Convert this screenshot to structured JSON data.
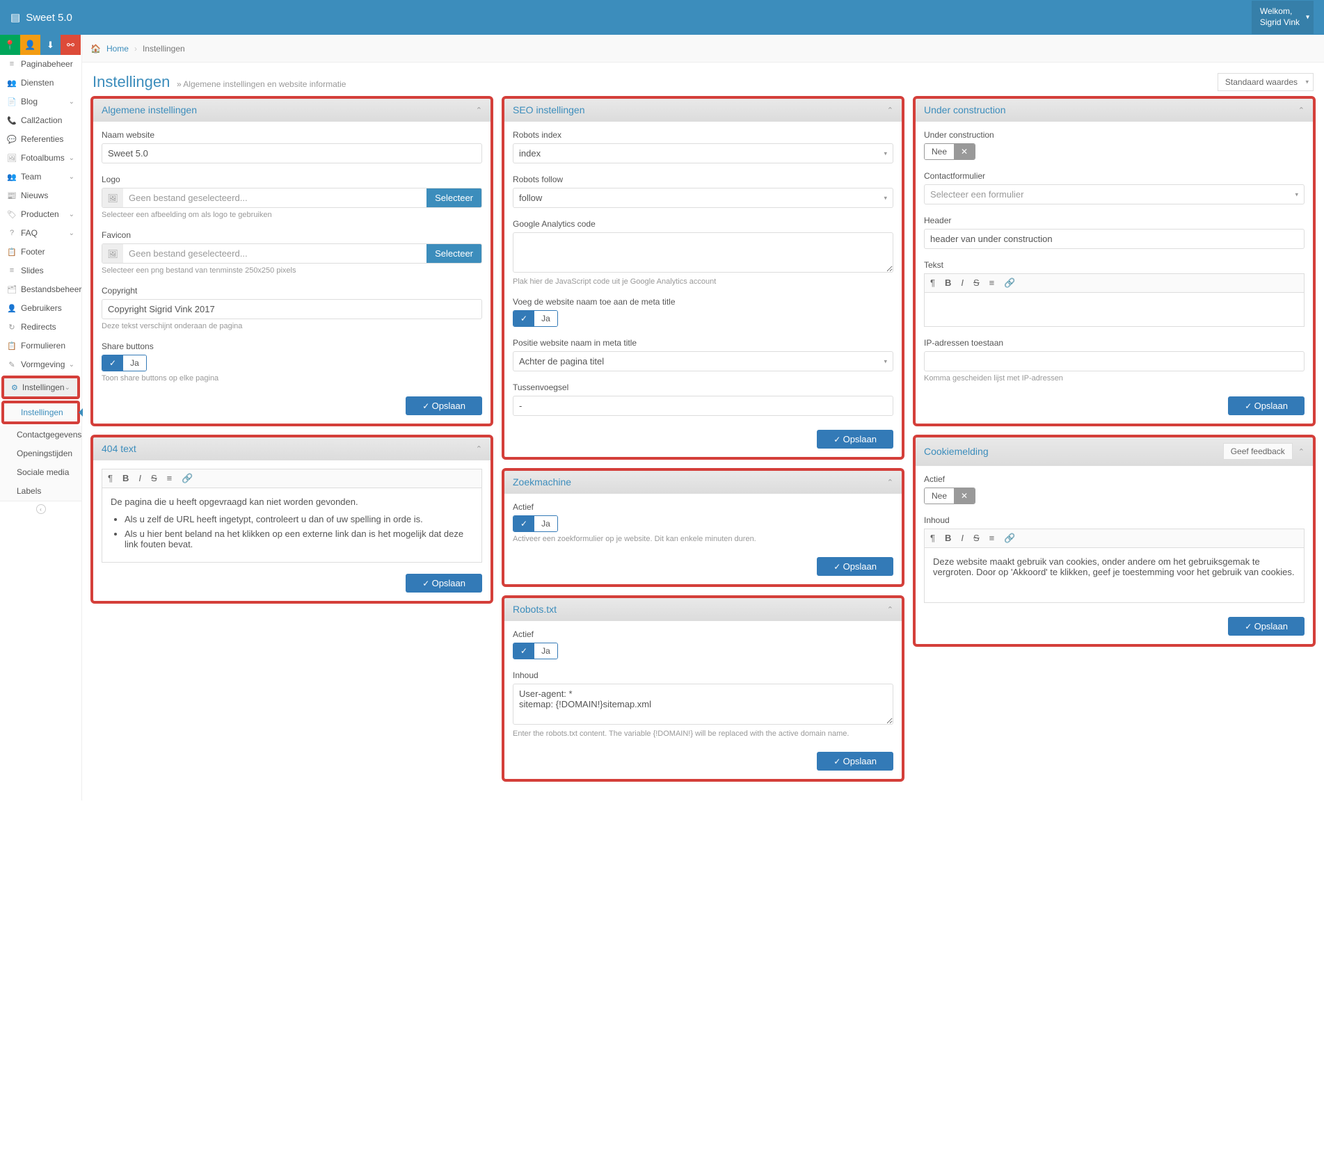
{
  "app": {
    "name": "Sweet 5.0",
    "welcome": "Welkom,",
    "user": "Sigrid Vink"
  },
  "breadcrumb": {
    "home": "Home",
    "current": "Instellingen"
  },
  "page": {
    "title": "Instellingen",
    "subtitle": "» Algemene instellingen en website informatie",
    "defaults": "Standaard waardes"
  },
  "sidebarBtns": [
    "map-marker",
    "user",
    "download",
    "share"
  ],
  "menu": [
    {
      "icon": "≡",
      "label": "Paginabeheer"
    },
    {
      "icon": "👥",
      "label": "Diensten"
    },
    {
      "icon": "📄",
      "label": "Blog",
      "chev": true
    },
    {
      "icon": "📞",
      "label": "Call2action"
    },
    {
      "icon": "💬",
      "label": "Referenties"
    },
    {
      "icon": "🖼",
      "label": "Fotoalbums",
      "chev": true
    },
    {
      "icon": "👥",
      "label": "Team",
      "chev": true
    },
    {
      "icon": "📰",
      "label": "Nieuws"
    },
    {
      "icon": "🏷",
      "label": "Producten",
      "chev": true
    },
    {
      "icon": "?",
      "label": "FAQ",
      "chev": true
    },
    {
      "icon": "📋",
      "label": "Footer"
    },
    {
      "icon": "≡",
      "label": "Slides"
    },
    {
      "icon": "🗂",
      "label": "Bestandsbeheer"
    },
    {
      "icon": "👤",
      "label": "Gebruikers"
    },
    {
      "icon": "↻",
      "label": "Redirects"
    },
    {
      "icon": "📋",
      "label": "Formulieren"
    },
    {
      "icon": "✎",
      "label": "Vormgeving",
      "chev": true
    },
    {
      "icon": "⚙",
      "label": "Instellingen",
      "chev": true,
      "activeParent": true
    }
  ],
  "submenu": [
    {
      "label": "Instellingen",
      "active": true
    },
    {
      "label": "Contactgegevens"
    },
    {
      "label": "Openingstijden"
    },
    {
      "label": "Sociale media"
    },
    {
      "label": "Labels"
    }
  ],
  "btn": {
    "save": "Opslaan",
    "select": "Selecteer"
  },
  "toggle": {
    "yes": "Ja",
    "no": "Nee"
  },
  "panels": {
    "general": {
      "title": "Algemene instellingen",
      "name_label": "Naam website",
      "name_value": "Sweet 5.0",
      "logo_label": "Logo",
      "logo_placeholder": "Geen bestand geselecteerd...",
      "logo_help": "Selecteer een afbeelding om als logo te gebruiken",
      "favicon_label": "Favicon",
      "favicon_placeholder": "Geen bestand geselecteerd...",
      "favicon_help": "Selecteer een png bestand van tenminste 250x250 pixels",
      "copyright_label": "Copyright",
      "copyright_value": "Copyright Sigrid Vink 2017",
      "copyright_help": "Deze tekst verschijnt onderaan de pagina",
      "share_label": "Share buttons",
      "share_help": "Toon share buttons op elke pagina"
    },
    "t404": {
      "title": "404 text",
      "body_p": "De pagina die u heeft opgevraagd kan niet worden gevonden.",
      "body_li1": "Als u zelf de URL heeft ingetypt, controleert u dan of uw spelling in orde is.",
      "body_li2": "Als u hier bent beland na het klikken op een externe link dan is het mogelijk dat deze link fouten bevat."
    },
    "seo": {
      "title": "SEO instellingen",
      "idx_label": "Robots index",
      "idx_value": "index",
      "follow_label": "Robots follow",
      "follow_value": "follow",
      "ga_label": "Google Analytics code",
      "ga_help": "Plak hier de JavaScript code uit je Google Analytics account",
      "append_label": "Voeg de website naam toe aan de meta title",
      "pos_label": "Positie website naam in meta title",
      "pos_value": "Achter de pagina titel",
      "infix_label": "Tussenvoegsel",
      "infix_value": "-"
    },
    "search": {
      "title": "Zoekmachine",
      "active_label": "Actief",
      "help": "Activeer een zoekformulier op je website. Dit kan enkele minuten duren."
    },
    "robots": {
      "title": "Robots.txt",
      "active_label": "Actief",
      "content_label": "Inhoud",
      "content_value": "User-agent: *\nsitemap: {!DOMAIN!}sitemap.xml",
      "help": "Enter the robots.txt content. The variable {!DOMAIN!} will be replaced with the active domain name."
    },
    "uc": {
      "title": "Under construction",
      "uc_label": "Under construction",
      "form_label": "Contactformulier",
      "form_placeholder": "Selecteer een formulier",
      "header_label": "Header",
      "header_value": "header van under construction",
      "text_label": "Tekst",
      "ip_label": "IP-adressen toestaan",
      "ip_help": "Komma gescheiden lijst met IP-adressen"
    },
    "cookie": {
      "title": "Cookiemelding",
      "feedback": "Geef feedback",
      "active_label": "Actief",
      "content_label": "Inhoud",
      "content_body": "Deze website maakt gebruik van cookies, onder andere om het gebruiksgemak te vergroten. Door op 'Akkoord' te klikken, geef je toestemming voor het gebruik van cookies."
    }
  }
}
